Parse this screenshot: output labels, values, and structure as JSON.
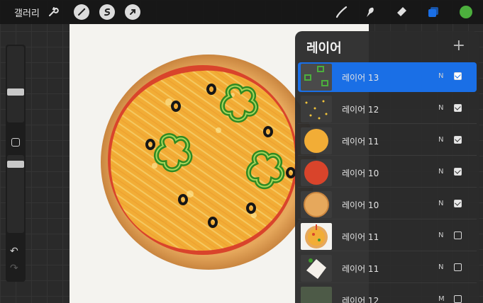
{
  "topbar": {
    "gallery_label": "갤러리",
    "left_tools": [
      "wrench-icon",
      "magic-wand-icon",
      "selection-icon",
      "transform-arrow-icon"
    ],
    "right_tools": [
      "brush-icon",
      "smudge-icon",
      "eraser-icon",
      "layers-icon",
      "color-swatch"
    ],
    "active_color": "#4caf3d"
  },
  "sidebar": {
    "tools": [
      "brush-size-slider",
      "modify-square",
      "opacity-slider",
      "undo-icon",
      "redo-icon"
    ]
  },
  "layers": {
    "title": "레이어",
    "add_icon": "+",
    "items": [
      {
        "name": "레이어 13",
        "blend": "N",
        "visible": true,
        "active": true
      },
      {
        "name": "레이어 12",
        "blend": "N",
        "visible": true,
        "active": false
      },
      {
        "name": "레이어 11",
        "blend": "N",
        "visible": true,
        "active": false
      },
      {
        "name": "레이어 10",
        "blend": "N",
        "visible": true,
        "active": false
      },
      {
        "name": "레이어 10",
        "blend": "N",
        "visible": true,
        "active": false
      },
      {
        "name": "레이어 11",
        "blend": "N",
        "visible": false,
        "active": false
      },
      {
        "name": "레이어 11",
        "blend": "N",
        "visible": false,
        "active": false
      },
      {
        "name": "레이어 12",
        "blend": "M",
        "visible": false,
        "active": false
      }
    ]
  },
  "colors": {
    "accent": "#1a6fe6",
    "crust": "#d99a52",
    "sauce": "#d9442b",
    "cheese": "#f2b23a",
    "pepper": "#3f9a2e",
    "olive": "#1a1a1a"
  }
}
